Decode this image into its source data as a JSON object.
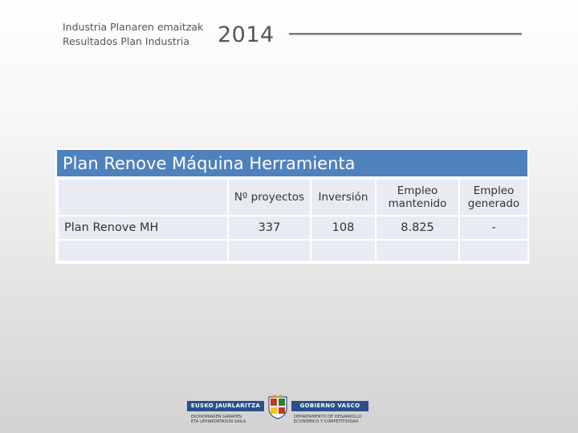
{
  "header": {
    "line1": "Industria Planaren emaitzak",
    "line2": "Resultados Plan Industria",
    "year": "2014"
  },
  "table": {
    "title": "Plan Renove Máquina Herramienta",
    "columns": [
      "",
      "Nº proyectos",
      "Inversión",
      "Empleo mantenido",
      "Empleo generado"
    ],
    "rows": [
      [
        "Plan Renove MH",
        "337",
        "108",
        "8.825",
        "-"
      ],
      [
        "",
        "",
        "",
        "",
        ""
      ]
    ]
  },
  "logo": {
    "left_name": "EUSKO JAURLARITZA",
    "right_name": "GOBIERNO VASCO",
    "left_dept_1": "EKONOMIAREN GARAPEN",
    "left_dept_2": "ETA LEHIAKORTASUN SAILA",
    "right_dept_1": "DEPARTAMENTO DE DESARROLLO",
    "right_dept_2": "ECONÓMICO Y COMPETITIVIDAD"
  }
}
